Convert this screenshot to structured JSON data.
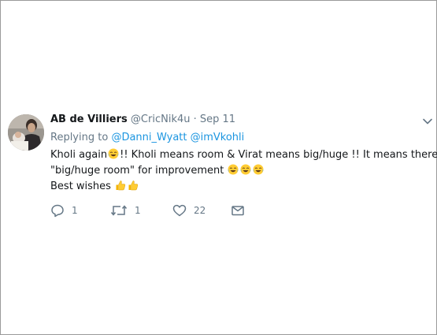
{
  "tweet": {
    "author_name": "AB de Villiers",
    "handle": "@CricNik4u",
    "separator": "·",
    "date": "Sep 11",
    "replying_to_prefix": "Replying to",
    "mentions": [
      "@Danni_Wyatt",
      "@imVkohli"
    ],
    "text": {
      "line1_a": "Kholi again",
      "line1_b": "!! Kholi means room & Virat means big/huge !! It means there's",
      "line2_a": "\"big/huge room\" for improvement",
      "line3_a": "Best wishes"
    },
    "emojis": {
      "line1": [
        "face-with-tears-of-joy-emoji"
      ],
      "line2": [
        "face-with-tears-of-joy-emoji",
        "face-with-tears-of-joy-emoji",
        "face-with-tears-of-joy-emoji"
      ],
      "line3": [
        "thumbs-up-emoji",
        "thumbs-up-emoji"
      ]
    },
    "actions": {
      "reply_count": "1",
      "retweet_count": "1",
      "like_count": "22"
    },
    "colors": {
      "link": "#1b95e0",
      "secondary": "#657786",
      "primary": "#14171a"
    }
  }
}
